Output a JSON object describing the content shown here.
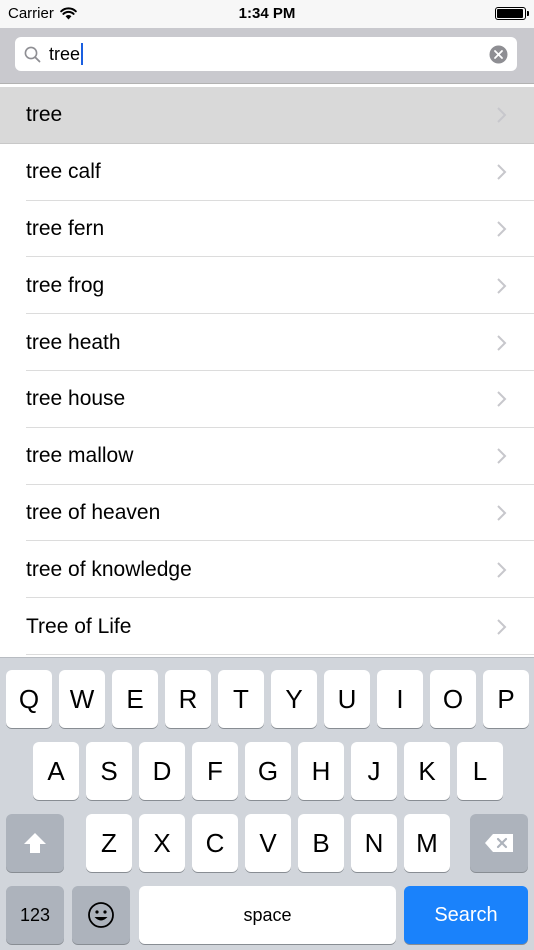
{
  "status_bar": {
    "carrier": "Carrier",
    "time": "1:34 PM",
    "battery_level": 0.95
  },
  "search": {
    "value": "tree",
    "icon": "magnifier-icon",
    "clear_icon": "clear-x-icon"
  },
  "results": [
    {
      "label": "tree",
      "highlighted": true
    },
    {
      "label": "tree calf"
    },
    {
      "label": "tree fern"
    },
    {
      "label": "tree frog"
    },
    {
      "label": "tree heath"
    },
    {
      "label": "tree house"
    },
    {
      "label": "tree mallow"
    },
    {
      "label": "tree of heaven"
    },
    {
      "label": "tree of knowledge"
    },
    {
      "label": "Tree of Life"
    }
  ],
  "keyboard": {
    "row1": [
      "Q",
      "W",
      "E",
      "R",
      "T",
      "Y",
      "U",
      "I",
      "O",
      "P"
    ],
    "row2": [
      "A",
      "S",
      "D",
      "F",
      "G",
      "H",
      "J",
      "K",
      "L"
    ],
    "row3": [
      "Z",
      "X",
      "C",
      "V",
      "B",
      "N",
      "M"
    ],
    "numbers_label": "123",
    "space_label": "space",
    "search_label": "Search",
    "shift_icon": "shift-arrow-icon",
    "delete_icon": "backspace-icon",
    "emoji_icon": "emoji-smiley-icon"
  },
  "colors": {
    "accent": "#1a82fb",
    "highlight_row": "#d9d9d9",
    "keyboard_bg": "#d1d5db"
  }
}
